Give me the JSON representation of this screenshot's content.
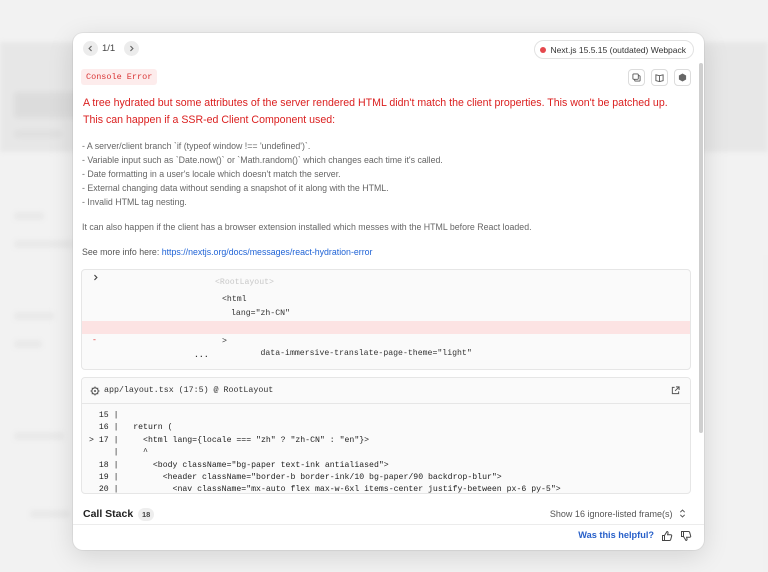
{
  "nav": {
    "prev_icon": "chevron-left-icon",
    "next_icon": "chevron-right-icon",
    "pager": "1/1"
  },
  "version": {
    "label": "Next.js 15.5.15 (outdated) Webpack",
    "status_color": "#e5484d"
  },
  "error": {
    "label": "Console Error",
    "message": "A tree hydrated but some attributes of the server rendered HTML didn't match the client properties. This won't be patched up. This can happen if a SSR-ed Client Component used:",
    "bullets": [
      "- A server/client branch `if (typeof window !== 'undefined')`.",
      "- Variable input such as `Date.now()` or `Math.random()` which changes each time it's called.",
      "- Date formatting in a user's locale which doesn't match the server.",
      "- External changing data without sending a snapshot of it along with the HTML.",
      "- Invalid HTML tag nesting."
    ],
    "note": "It can also happen if the client has a browser extension installed which messes with the HTML before React loaded.",
    "more_prefix": "See more info here:",
    "more_link": "https://nextjs.org/docs/messages/react-hydration-error"
  },
  "tools": [
    "copy-icon",
    "docs-icon",
    "node-icon"
  ],
  "diff": {
    "expand_icon": "chevron-right-icon",
    "faded": "<RootLayout>",
    "lines": [
      "<html",
      "lang=\"zh-CN\"",
      "data-immersive-translate-page-theme=\"light\"",
      ">",
      "..."
    ],
    "removed_marker": "-"
  },
  "code_frame": {
    "file": "app/layout.tsx (17:5) @ RootLayout",
    "lines": [
      "  15 |",
      "  16 |   return (",
      "> 17 |     <html lang={locale === \"zh\" ? \"zh-CN\" : \"en\"}>",
      "     |     ^",
      "  18 |       <body className=\"bg-paper text-ink antialiased\">",
      "  19 |         <header className=\"border-b border-ink/10 bg-paper/90 backdrop-blur\">",
      "  20 |           <nav className=\"mx-auto flex max-w-6xl items-center justify-between px-6 py-5\">"
    ]
  },
  "footer": {
    "call_stack": "Call Stack",
    "count": "18",
    "show_frames": "Show 16 ignore-listed frame(s)",
    "helpful": "Was this helpful?"
  }
}
